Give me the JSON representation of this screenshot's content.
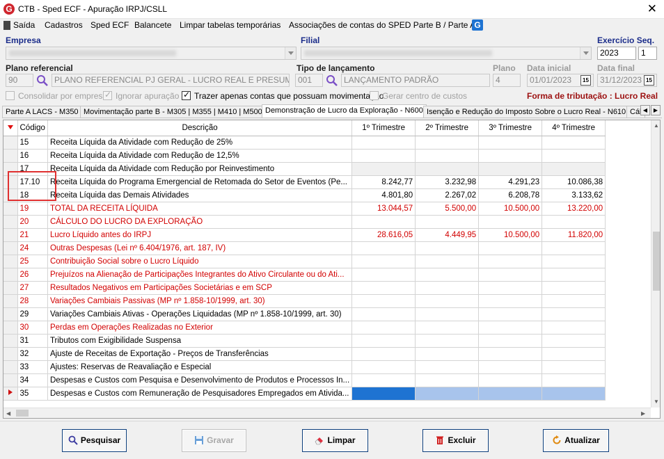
{
  "window": {
    "title": "CTB - Sped ECF - Apuração IRPJ/CSLL",
    "close": "✕",
    "app_icon": "G"
  },
  "menu": [
    "Saída",
    "Cadastros",
    "Sped ECF",
    "Balancete",
    "Limpar tabelas temporárias",
    "Associações de contas do SPED Parte B / Parte A"
  ],
  "menu_icon": "G",
  "form": {
    "empresa_label": "Empresa",
    "filial_label": "Filial",
    "exercicio_label": "Exercício",
    "seq_label": "Seq.",
    "exercicio": "2023",
    "seq": "1",
    "plano_ref_label": "Plano referencial",
    "plano_ref_code": "90",
    "plano_ref_desc": "PLANO REFERENCIAL PJ GERAL - LUCRO REAL E PRESUMIDO ANTERIOR",
    "tipo_label": "Tipo de lançamento",
    "tipo_code": "001",
    "tipo_desc": "LANÇAMENTO PADRÃO",
    "plano_label": "Plano",
    "plano": "4",
    "data_inicial_label": "Data inicial",
    "data_inicial": "01/01/2023",
    "data_final_label": "Data final",
    "data_final": "31/12/2023",
    "calendar_label": "15",
    "consolidar": "Consolidar por empresa",
    "ignorar": "Ignorar apuração",
    "trazer": "Trazer apenas contas que possuam movimentação",
    "gerar": "Gerar centro de custos",
    "forma": "Forma de tributação : Lucro Real"
  },
  "tabs": [
    "Parte A LACS - M350",
    "Movimentação parte B - M305 | M355 | M410 | M500",
    "Demonstração de Lucro da Exploração - N600",
    "Isenção e Redução do Imposto Sobre o Lucro Real - N610",
    "Cál"
  ],
  "tab_arrows": {
    "left": "◀",
    "right": "▶"
  },
  "grid": {
    "headers": [
      "Código",
      "Descrição",
      "1º Trimestre",
      "2º Trimestre",
      "3º Trimestre",
      "4º Trimestre"
    ],
    "rows": [
      {
        "code": "15",
        "desc": "Receita Líquida da Atividade com Redução de 25%",
        "q": [
          "",
          "",
          "",
          ""
        ],
        "red": false,
        "shade": false
      },
      {
        "code": "16",
        "desc": "Receita Líquida da Atividade com Redução de 12,5%",
        "q": [
          "",
          "",
          "",
          ""
        ],
        "red": false,
        "shade": false
      },
      {
        "code": "17",
        "desc": "Receita Líquida da Atividade com Redução por Reinvestimento",
        "q": [
          "",
          "",
          "",
          ""
        ],
        "red": false,
        "shade": true
      },
      {
        "code": "17.10",
        "desc": "Receita Líquida do Programa Emergencial de Retomada do Setor de Eventos (Pe...",
        "q": [
          "8.242,77",
          "3.232,98",
          "4.291,23",
          "10.086,38"
        ],
        "red": false,
        "shade": false
      },
      {
        "code": "18",
        "desc": "Receita Líquida das Demais Atividades",
        "q": [
          "4.801,80",
          "2.267,02",
          "6.208,78",
          "3.133,62"
        ],
        "red": false,
        "shade": false
      },
      {
        "code": "19",
        "desc": "TOTAL DA RECEITA LÍQUIDA",
        "q": [
          "13.044,57",
          "5.500,00",
          "10.500,00",
          "13.220,00"
        ],
        "red": true,
        "shade": false
      },
      {
        "code": "20",
        "desc": "CÁLCULO DO LUCRO DA EXPLORAÇÃO",
        "q": [
          "",
          "",
          "",
          ""
        ],
        "red": true,
        "shade": false
      },
      {
        "code": "21",
        "desc": "Lucro Líquido antes do IRPJ",
        "q": [
          "28.616,05",
          "4.449,95",
          "10.500,00",
          "11.820,00"
        ],
        "red": true,
        "shade": false
      },
      {
        "code": "24",
        "desc": "Outras Despesas (Lei nº 6.404/1976, art. 187, IV)",
        "q": [
          "",
          "",
          "",
          ""
        ],
        "red": true,
        "shade": false
      },
      {
        "code": "25",
        "desc": "Contribuição Social sobre o Lucro Líquido",
        "q": [
          "",
          "",
          "",
          ""
        ],
        "red": true,
        "shade": false
      },
      {
        "code": "26",
        "desc": "Prejuízos na Alienação de Participações Integrantes do Ativo Circulante ou do Ati...",
        "q": [
          "",
          "",
          "",
          ""
        ],
        "red": true,
        "shade": false
      },
      {
        "code": "27",
        "desc": "Resultados Negativos em Participações Societárias e em SCP",
        "q": [
          "",
          "",
          "",
          ""
        ],
        "red": true,
        "shade": false
      },
      {
        "code": "28",
        "desc": "Variações Cambiais Passivas (MP nº 1.858-10/1999, art. 30)",
        "q": [
          "",
          "",
          "",
          ""
        ],
        "red": true,
        "shade": false
      },
      {
        "code": "29",
        "desc": "Variações Cambiais Ativas - Operações Liquidadas (MP nº 1.858-10/1999, art. 30)",
        "q": [
          "",
          "",
          "",
          ""
        ],
        "red": false,
        "shade": false
      },
      {
        "code": "30",
        "desc": "Perdas em Operações Realizadas no Exterior",
        "q": [
          "",
          "",
          "",
          ""
        ],
        "red": true,
        "shade": false
      },
      {
        "code": "31",
        "desc": "Tributos com Exigibilidade Suspensa",
        "q": [
          "",
          "",
          "",
          ""
        ],
        "red": false,
        "shade": false
      },
      {
        "code": "32",
        "desc": "Ajuste de Receitas de Exportação - Preços de Transferências",
        "q": [
          "",
          "",
          "",
          ""
        ],
        "red": false,
        "shade": false
      },
      {
        "code": "33",
        "desc": "Ajustes: Reservas de Reavaliação e Especial",
        "q": [
          "",
          "",
          "",
          ""
        ],
        "red": false,
        "shade": false
      },
      {
        "code": "34",
        "desc": "Despesas e Custos com Pesquisa e Desenvolvimento de Produtos e Processos In...",
        "q": [
          "",
          "",
          "",
          ""
        ],
        "red": false,
        "shade": false
      },
      {
        "code": "35",
        "desc": "Despesas e Custos com Remuneração de Pesquisadores Empregados em Ativida...",
        "q": [
          "",
          "",
          "",
          ""
        ],
        "red": false,
        "shade": false,
        "selected": true
      }
    ]
  },
  "buttons": {
    "pesquisar": "Pesquisar",
    "gravar": "Gravar",
    "limpar": "Limpar",
    "excluir": "Excluir",
    "atualizar": "Atualizar"
  },
  "colors": {
    "label_blue": "#1a2c8a",
    "red_text": "#d20000",
    "selection_blue": "#1e73d2",
    "selection_light": "#a8c4ec",
    "forma_red": "#9c1010"
  }
}
